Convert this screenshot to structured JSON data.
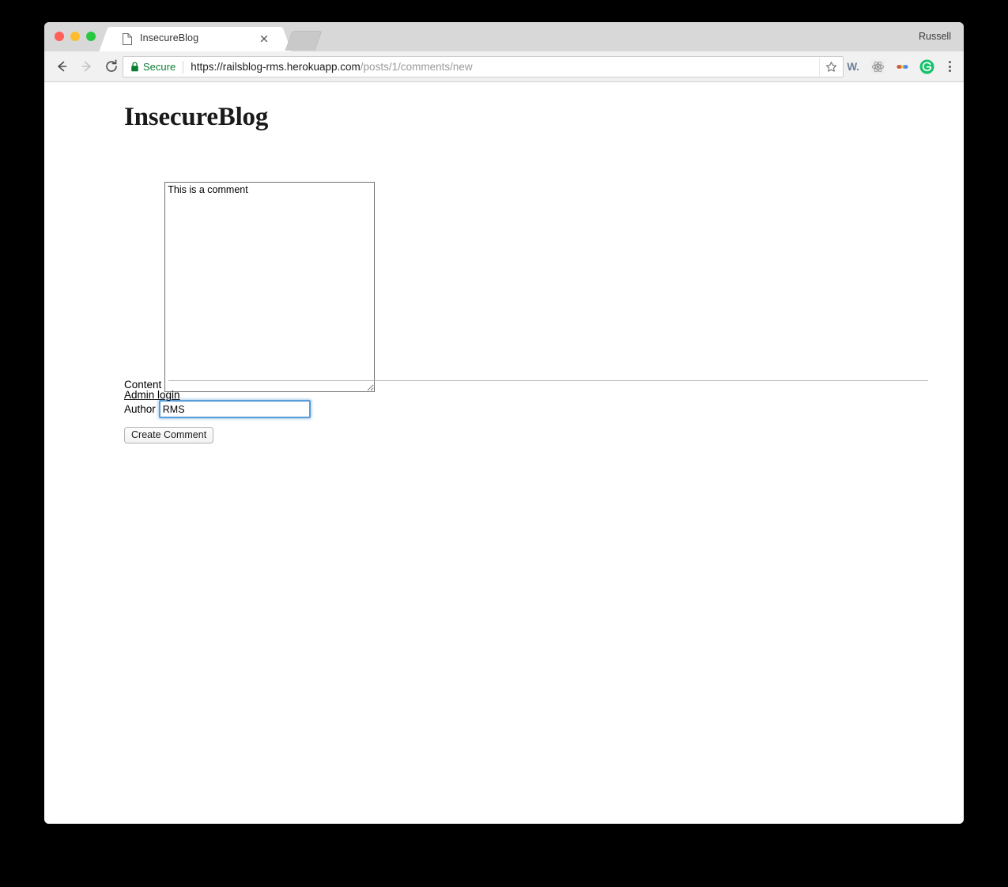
{
  "browser": {
    "window_controls": [
      "close",
      "minimize",
      "maximize"
    ],
    "tab": {
      "title": "InsecureBlog",
      "favicon": "page-icon",
      "close_label": "×"
    },
    "new_tab_label": "+",
    "profile_name": "Russell",
    "nav": {
      "back": "←",
      "forward": "→",
      "reload": "⟳"
    },
    "omnibox": {
      "security_label": "Secure",
      "lock_icon": "lock-icon",
      "url_domain": "https://railsblog-rms.herokuapp.com",
      "url_path": "/posts/1/comments/new",
      "bookmark_icon": "star-icon"
    },
    "extensions": [
      {
        "name": "wikiwand-extension-icon",
        "label": "W."
      },
      {
        "name": "react-devtools-extension-icon",
        "label": ""
      },
      {
        "name": "link-extension-icon",
        "label": ""
      },
      {
        "name": "grammarly-extension-icon",
        "label": "G"
      }
    ],
    "menu_icon": "three-dot-menu-icon"
  },
  "page": {
    "heading": "InsecureBlog",
    "form": {
      "content_label": "Content",
      "content_value": "This is a comment",
      "author_label": "Author",
      "author_value": "RMS",
      "submit_label": "Create Comment"
    },
    "admin_login_label": "Admin login"
  },
  "colors": {
    "secure_green": "#0b7d33",
    "focus_blue": "#5b9dd9",
    "grammarly_green": "#15c26b",
    "tab_strip": "#d8d8d8",
    "toolbar": "#f1f1f1",
    "page_background": "#ffffff",
    "outer_background": "#000000"
  }
}
